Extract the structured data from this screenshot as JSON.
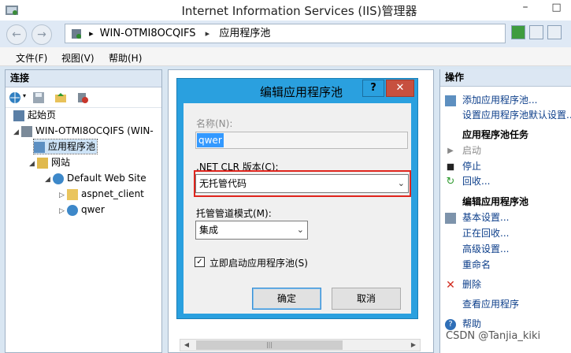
{
  "window": {
    "title": "Internet Information Services (IIS)管理器",
    "minimize": "–",
    "maximize": "□"
  },
  "address": {
    "server": "WIN-OTMI8OCQIFS",
    "page": "应用程序池",
    "separator": "▸"
  },
  "menu": [
    "文件(F)",
    "视图(V)",
    "帮助(H)"
  ],
  "connections": {
    "header": "连接",
    "tree": [
      {
        "label": "起始页",
        "icon": "start-page-icon"
      },
      {
        "label": "WIN-OTMI8OCQIFS (WIN-",
        "icon": "server-icon"
      },
      {
        "label": "应用程序池",
        "icon": "app-pool-icon"
      },
      {
        "label": "网站",
        "icon": "sites-folder-icon"
      },
      {
        "label": "Default Web Site",
        "icon": "globe-icon"
      },
      {
        "label": "aspnet_client",
        "icon": "folder-icon"
      },
      {
        "label": "qwer",
        "icon": "globe-icon"
      }
    ]
  },
  "dialog": {
    "title": "编辑应用程序池",
    "help": "?",
    "close": "✕",
    "name_label": "名称(N):",
    "name_value": "qwer",
    "clr_label": ".NET CLR 版本(C):",
    "clr_value": "无托管代码",
    "pipeline_label": "托管管道模式(M):",
    "pipeline_value": "集成",
    "autostart_label": "立即启动应用程序池(S)",
    "autostart_checked": "✓",
    "ok": "确定",
    "cancel": "取消"
  },
  "actions": {
    "header": "操作",
    "items": [
      {
        "label": "添加应用程序池...",
        "kind": "link",
        "icon": "add-pool-icon"
      },
      {
        "label": "设置应用程序池默认设置...",
        "kind": "link",
        "icon": ""
      },
      {
        "label": "应用程序池任务",
        "kind": "group",
        "icon": ""
      },
      {
        "label": "启动",
        "kind": "disabled",
        "icon": "play-icon"
      },
      {
        "label": "停止",
        "kind": "link",
        "icon": "stop-icon"
      },
      {
        "label": "回收...",
        "kind": "link",
        "icon": "recycle-icon"
      },
      {
        "label": "编辑应用程序池",
        "kind": "group",
        "icon": ""
      },
      {
        "label": "基本设置...",
        "kind": "link",
        "icon": "settings-icon"
      },
      {
        "label": "正在回收...",
        "kind": "link",
        "icon": ""
      },
      {
        "label": "高级设置...",
        "kind": "link",
        "icon": ""
      },
      {
        "label": "重命名",
        "kind": "link",
        "icon": ""
      },
      {
        "label": "删除",
        "kind": "link",
        "icon": "delete-icon"
      },
      {
        "label": "查看应用程序",
        "kind": "link",
        "icon": ""
      },
      {
        "label": "帮助",
        "kind": "link",
        "icon": "help-icon"
      }
    ]
  },
  "watermark": "CSDN @Tanjia_kiki"
}
